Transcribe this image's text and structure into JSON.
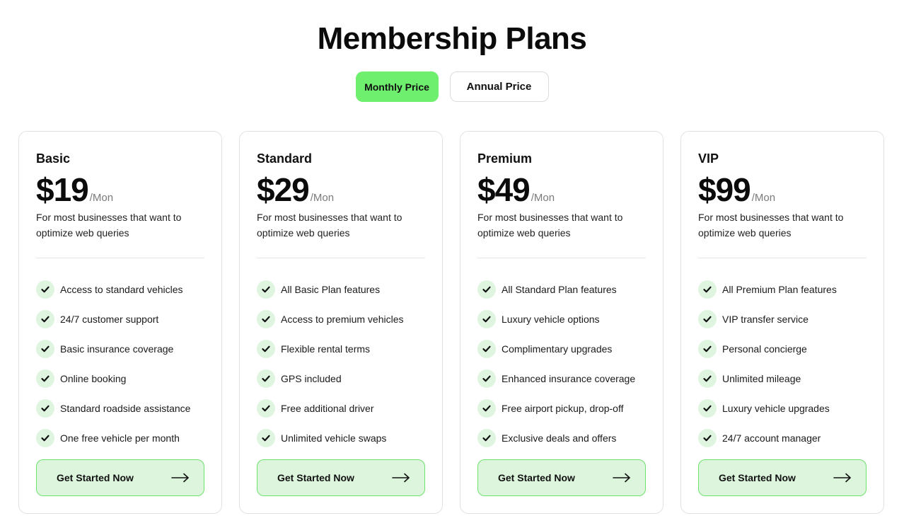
{
  "title": "Membership Plans",
  "toggle": {
    "monthly_label": "Monthly Price",
    "annual_label": "Annual Price",
    "selected": "Monthly Price"
  },
  "colors": {
    "accent": "#6ef06e",
    "cta_bg": "#dcf5dc",
    "check_bg": "#dff5df",
    "check_mark": "#111111"
  },
  "plans": [
    {
      "name": "Basic",
      "price": "$19",
      "period": "/Mon",
      "description": "For most businesses that want to optimize web queries",
      "features": [
        "Access to standard vehicles",
        "24/7 customer support",
        "Basic insurance coverage",
        "Online booking",
        "Standard roadside assistance",
        "One free vehicle per month"
      ],
      "cta": "Get Started Now"
    },
    {
      "name": "Standard",
      "price": "$29",
      "period": "/Mon",
      "description": "For most businesses that want to optimize web queries",
      "features": [
        "All Basic Plan features",
        "Access to premium vehicles",
        "Flexible rental terms",
        "GPS included",
        "Free additional driver",
        "Unlimited vehicle swaps"
      ],
      "cta": "Get Started Now"
    },
    {
      "name": "Premium",
      "price": "$49",
      "period": "/Mon",
      "description": "For most businesses that want to optimize web queries",
      "features": [
        "All Standard Plan features",
        "Luxury vehicle options",
        "Complimentary upgrades",
        "Enhanced insurance coverage",
        "Free airport pickup, drop-off",
        "Exclusive deals and offers"
      ],
      "cta": "Get Started Now"
    },
    {
      "name": "VIP",
      "price": "$99",
      "period": "/Mon",
      "description": "For most businesses that want to optimize web queries",
      "features": [
        "All Premium Plan features",
        "VIP transfer service",
        "Personal concierge",
        "Unlimited mileage",
        "Luxury vehicle upgrades",
        "24/7 account manager"
      ],
      "cta": "Get Started Now"
    }
  ]
}
